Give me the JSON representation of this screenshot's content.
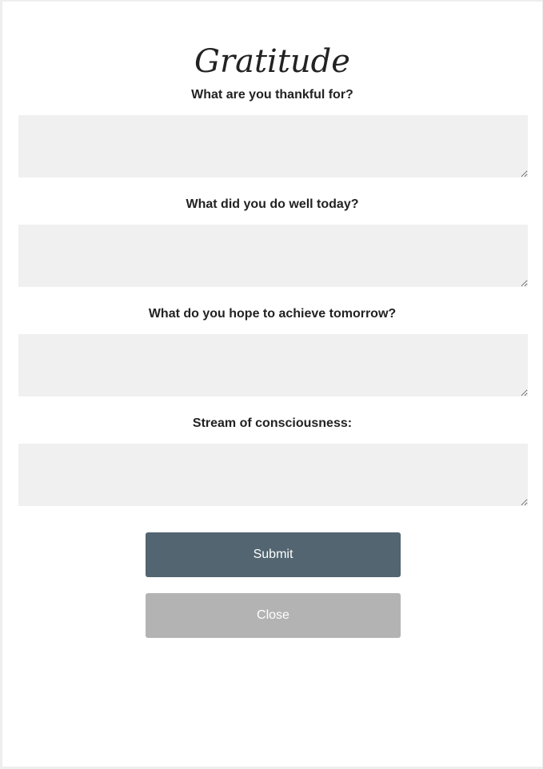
{
  "form": {
    "title": "Gratitude",
    "questions": [
      {
        "label": "What are you thankful for?",
        "value": ""
      },
      {
        "label": "What did you do well today?",
        "value": ""
      },
      {
        "label": "What do you hope to achieve tomorrow?",
        "value": ""
      },
      {
        "label": "Stream of consciousness:",
        "value": ""
      }
    ],
    "submit_label": "Submit",
    "close_label": "Close"
  },
  "colors": {
    "submit_button": "#526570",
    "close_button": "#b3b3b3",
    "field_background": "#f0f0f0"
  }
}
